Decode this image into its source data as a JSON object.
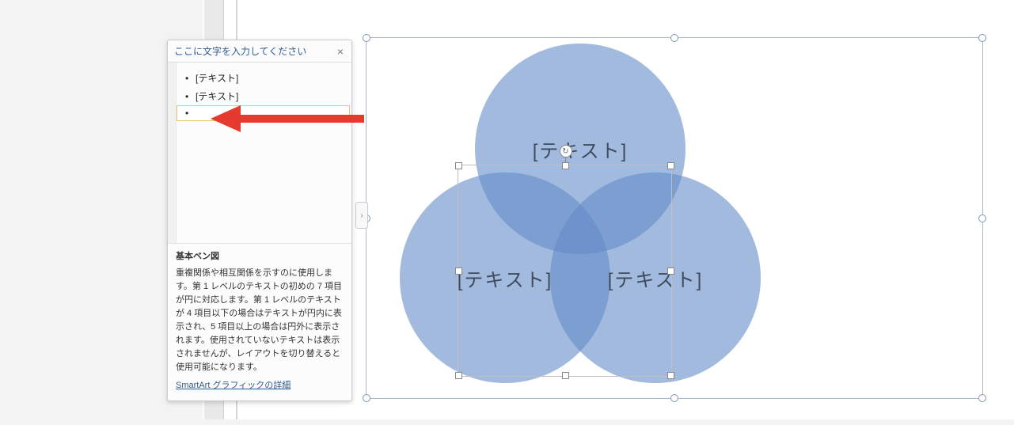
{
  "textpane": {
    "title": "ここに文字を入力してください",
    "items": [
      "[テキスト]",
      "[テキスト]",
      ""
    ],
    "desc_heading": "基本ベン図",
    "desc_body": "重複関係や相互関係を示すのに使用します。第 1 レベルのテキストの初めの 7 項目が円に対応します。第 1 レベルのテキストが 4 項目以下の場合はテキストが円内に表示され、5 項目以上の場合は円外に表示されます。使用されていないテキストは表示されませんが、レイアウトを切り替えると使用可能になります。",
    "link": "SmartArt グラフィックの詳細"
  },
  "venn": {
    "top": "[テキスト]",
    "left": "[テキスト]",
    "right": "[テキスト]"
  },
  "expand_glyph": "›",
  "rotate_glyph": "↻"
}
